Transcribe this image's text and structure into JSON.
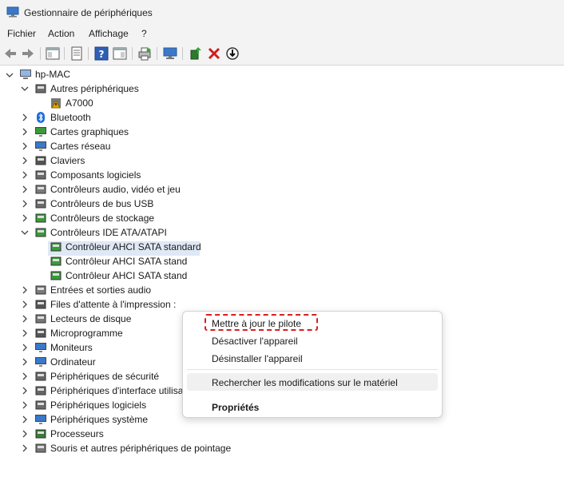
{
  "window": {
    "title": "Gestionnaire de périphériques"
  },
  "menu": [
    "Fichier",
    "Action",
    "Affichage",
    "?"
  ],
  "tree": {
    "root": "hp-MAC",
    "items": [
      {
        "label": "Autres périphériques",
        "icon": "unknown-device-icon",
        "expanded": true,
        "children": [
          {
            "label": "A7000",
            "icon": "warning-device-icon"
          }
        ]
      },
      {
        "label": "Bluetooth",
        "icon": "bluetooth-icon"
      },
      {
        "label": "Cartes graphiques",
        "icon": "display-adapter-icon"
      },
      {
        "label": "Cartes réseau",
        "icon": "network-adapter-icon"
      },
      {
        "label": "Claviers",
        "icon": "keyboard-icon"
      },
      {
        "label": "Composants logiciels",
        "icon": "software-component-icon"
      },
      {
        "label": "Contrôleurs audio, vidéo et jeu",
        "icon": "speaker-icon"
      },
      {
        "label": "Contrôleurs de bus USB",
        "icon": "usb-icon"
      },
      {
        "label": "Contrôleurs de stockage",
        "icon": "storage-controller-icon"
      },
      {
        "label": "Contrôleurs IDE ATA/ATAPI",
        "icon": "ide-controller-icon",
        "expanded": true,
        "children": [
          {
            "label": "Contrôleur AHCI SATA standard",
            "icon": "sata-controller-icon"
          },
          {
            "label": "Contrôleur AHCI SATA stand",
            "icon": "sata-controller-icon"
          },
          {
            "label": "Contrôleur AHCI SATA stand",
            "icon": "sata-controller-icon"
          }
        ]
      },
      {
        "label": "Entrées et sorties audio",
        "icon": "audio-io-icon"
      },
      {
        "label": "Files d'attente à l'impression :",
        "icon": "printer-icon"
      },
      {
        "label": "Lecteurs de disque",
        "icon": "disk-drive-icon"
      },
      {
        "label": "Microprogramme",
        "icon": "firmware-icon"
      },
      {
        "label": "Moniteurs",
        "icon": "monitor-icon"
      },
      {
        "label": "Ordinateur",
        "icon": "computer-icon"
      },
      {
        "label": "Périphériques de sécurité",
        "icon": "security-device-icon"
      },
      {
        "label": "Périphériques d'interface utilisateur",
        "icon": "hid-icon"
      },
      {
        "label": "Périphériques logiciels",
        "icon": "software-device-icon"
      },
      {
        "label": "Périphériques système",
        "icon": "system-device-icon"
      },
      {
        "label": "Processeurs",
        "icon": "processor-icon"
      },
      {
        "label": "Souris et autres périphériques de pointage",
        "icon": "mouse-icon"
      }
    ]
  },
  "context_menu": {
    "update_driver": "Mettre à jour le pilote",
    "disable_device": "Désactiver l'appareil",
    "uninstall_device": "Désinstaller l'appareil",
    "scan_changes": "Rechercher les modifications sur le matériel",
    "properties": "Propriétés"
  },
  "colors": {
    "highlight_dash": "#d81e1e",
    "selection": "#dfe8f5"
  }
}
